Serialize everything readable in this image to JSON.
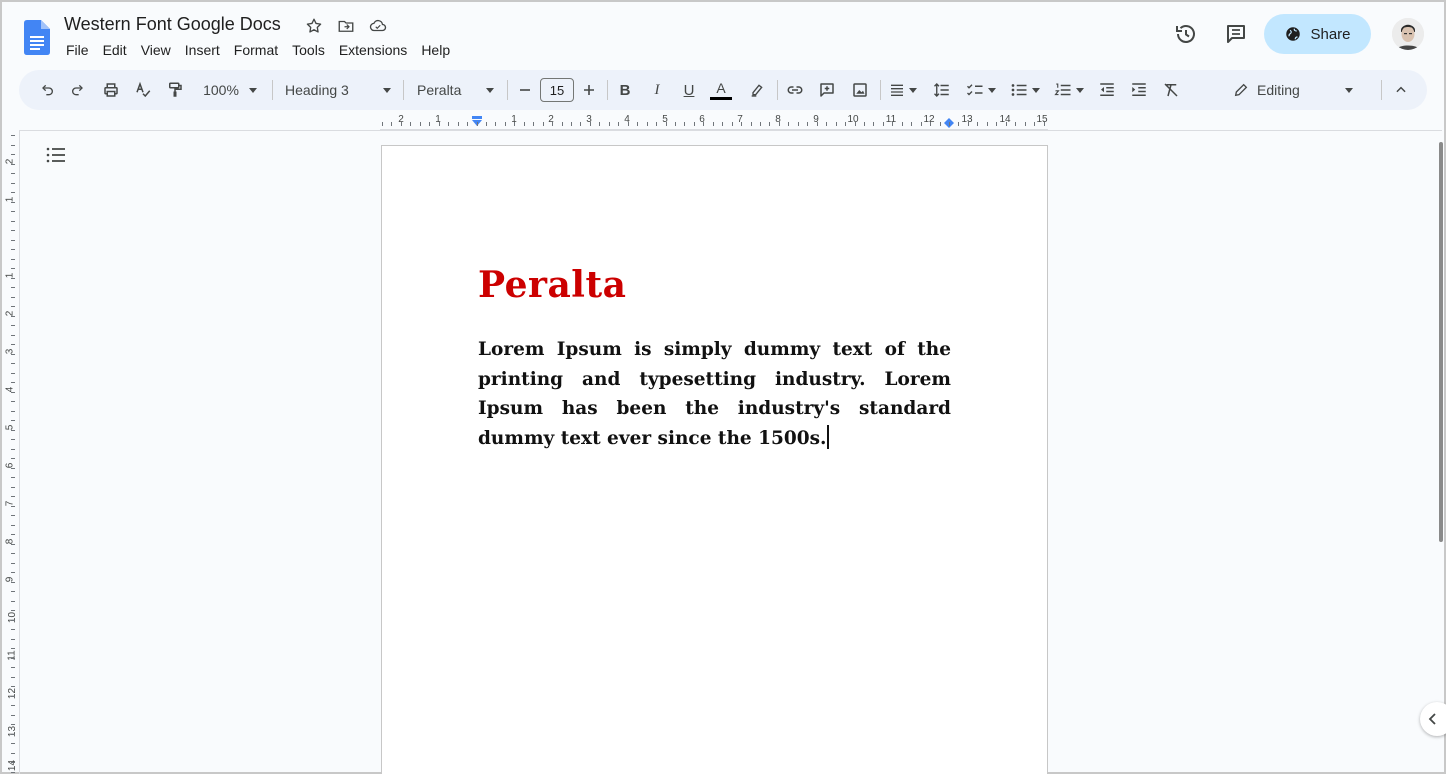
{
  "document": {
    "title": "Western Font Google Docs"
  },
  "menu": [
    "File",
    "Edit",
    "View",
    "Insert",
    "Format",
    "Tools",
    "Extensions",
    "Help"
  ],
  "share": {
    "label": "Share"
  },
  "toolbar": {
    "zoom": "100%",
    "style": "Heading 3",
    "font": "Peralta",
    "font_size": "15",
    "bold": "B",
    "italic": "I",
    "underline": "U",
    "text_color": "A",
    "mode": "Editing"
  },
  "ruler": {
    "h_numbers": [
      "2",
      "1",
      "1",
      "2",
      "3",
      "4",
      "5",
      "6",
      "7",
      "8",
      "9",
      "10",
      "11",
      "12",
      "13",
      "14",
      "15"
    ],
    "v_numbers": [
      "2",
      "1",
      "1",
      "2",
      "3",
      "4",
      "5",
      "6",
      "7",
      "8",
      "9",
      "10",
      "11",
      "12",
      "13",
      "14"
    ]
  },
  "content": {
    "heading": "Peralta",
    "body": "Lorem Ipsum is simply dummy text of the printing and typesetting industry. Lorem Ipsum has been the industry's standard dummy text ever since the 1500s."
  },
  "colors": {
    "heading": "#cc0000",
    "share_bg": "#c2e7ff",
    "toolbar_bg": "#edf2fa",
    "docs_blue": "#4285f4"
  },
  "icons": {
    "logo": "google-docs-logo",
    "history": "version-history-icon",
    "comments": "comments-icon",
    "share": "globe-icon"
  }
}
